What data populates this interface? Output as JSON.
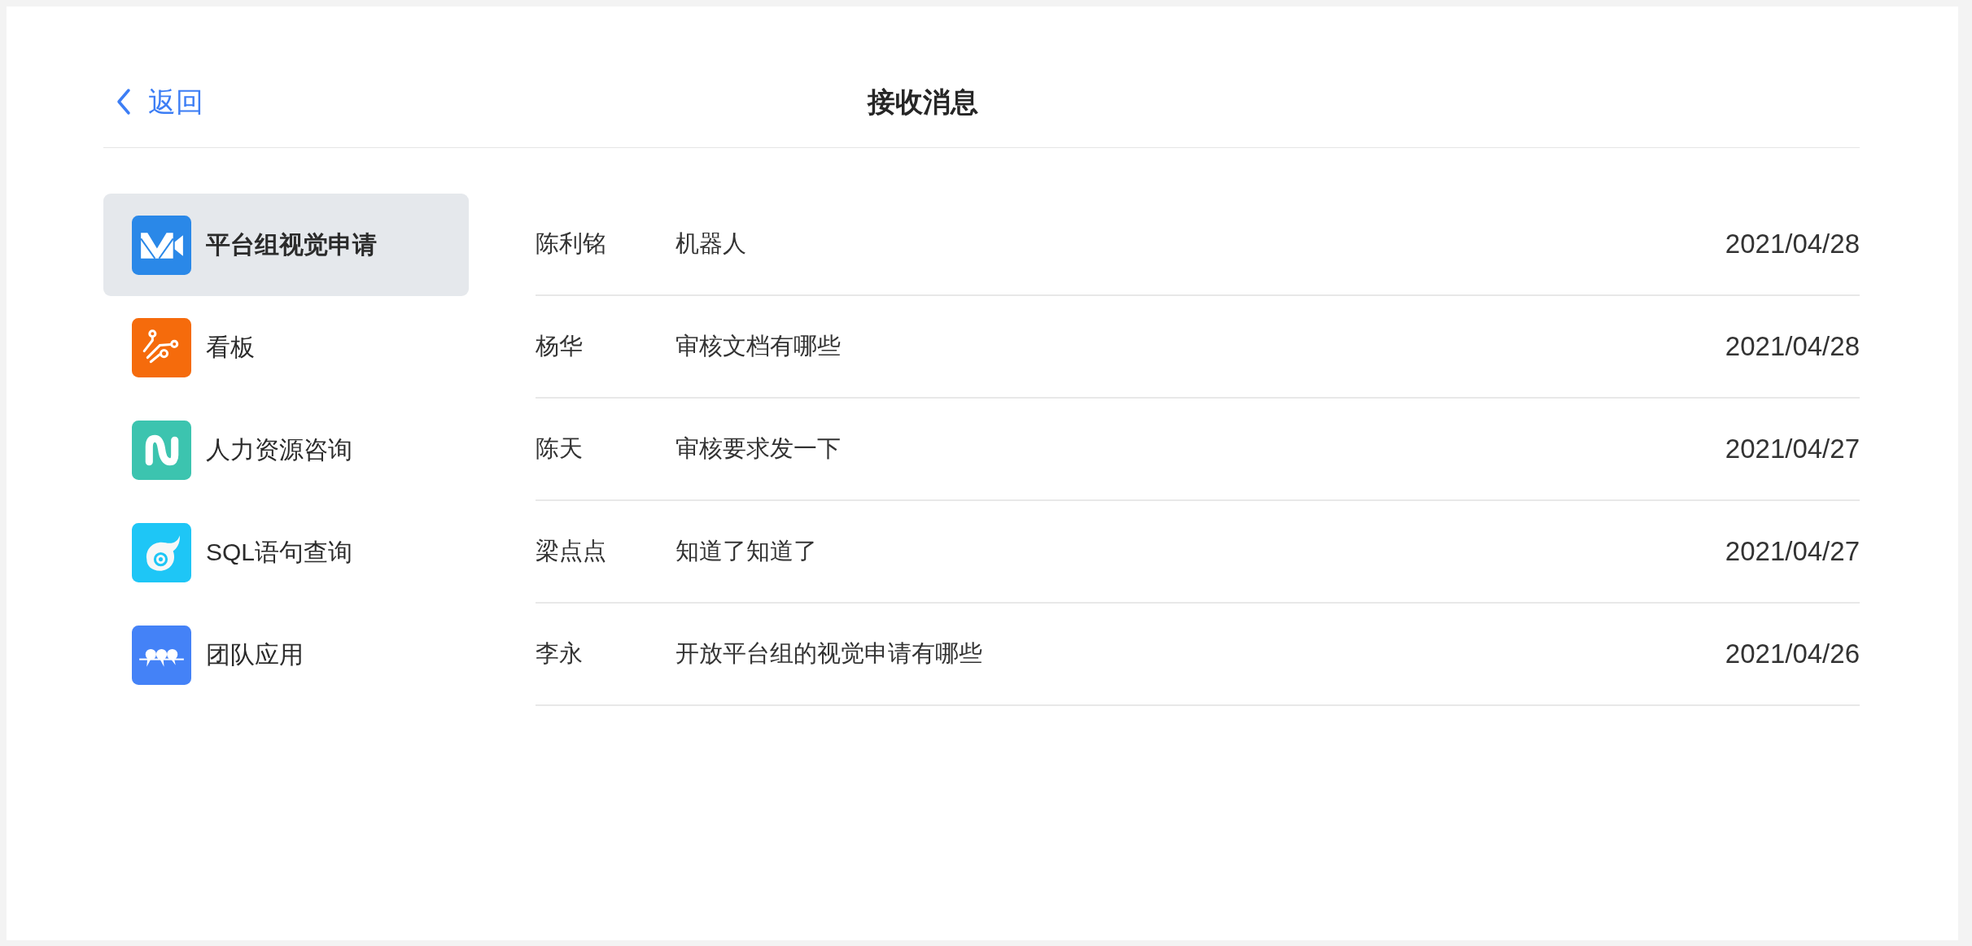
{
  "header": {
    "back": {
      "label": "返回"
    },
    "title": "接收消息"
  },
  "sidebar": {
    "items": [
      {
        "kind": "video",
        "label": "平台组视觉申请",
        "selected": true
      },
      {
        "kind": "circuit",
        "label": "看板",
        "selected": false
      },
      {
        "kind": "ribbon",
        "label": "人力资源咨询",
        "selected": false
      },
      {
        "kind": "swirl",
        "label": "SQL语句查询",
        "selected": false
      },
      {
        "kind": "people",
        "label": "团队应用",
        "selected": false
      }
    ]
  },
  "messages": [
    {
      "sender": "陈利铭",
      "text": "机器人",
      "date": "2021/04/28"
    },
    {
      "sender": "杨华",
      "text": "审核文档有哪些",
      "date": "2021/04/28"
    },
    {
      "sender": "陈天",
      "text": "审核要求发一下",
      "date": "2021/04/27"
    },
    {
      "sender": "梁点点",
      "text": "知道了知道了",
      "date": "2021/04/27"
    },
    {
      "sender": "李永",
      "text": "开放平台组的视觉申请有哪些",
      "date": "2021/04/26"
    }
  ]
}
